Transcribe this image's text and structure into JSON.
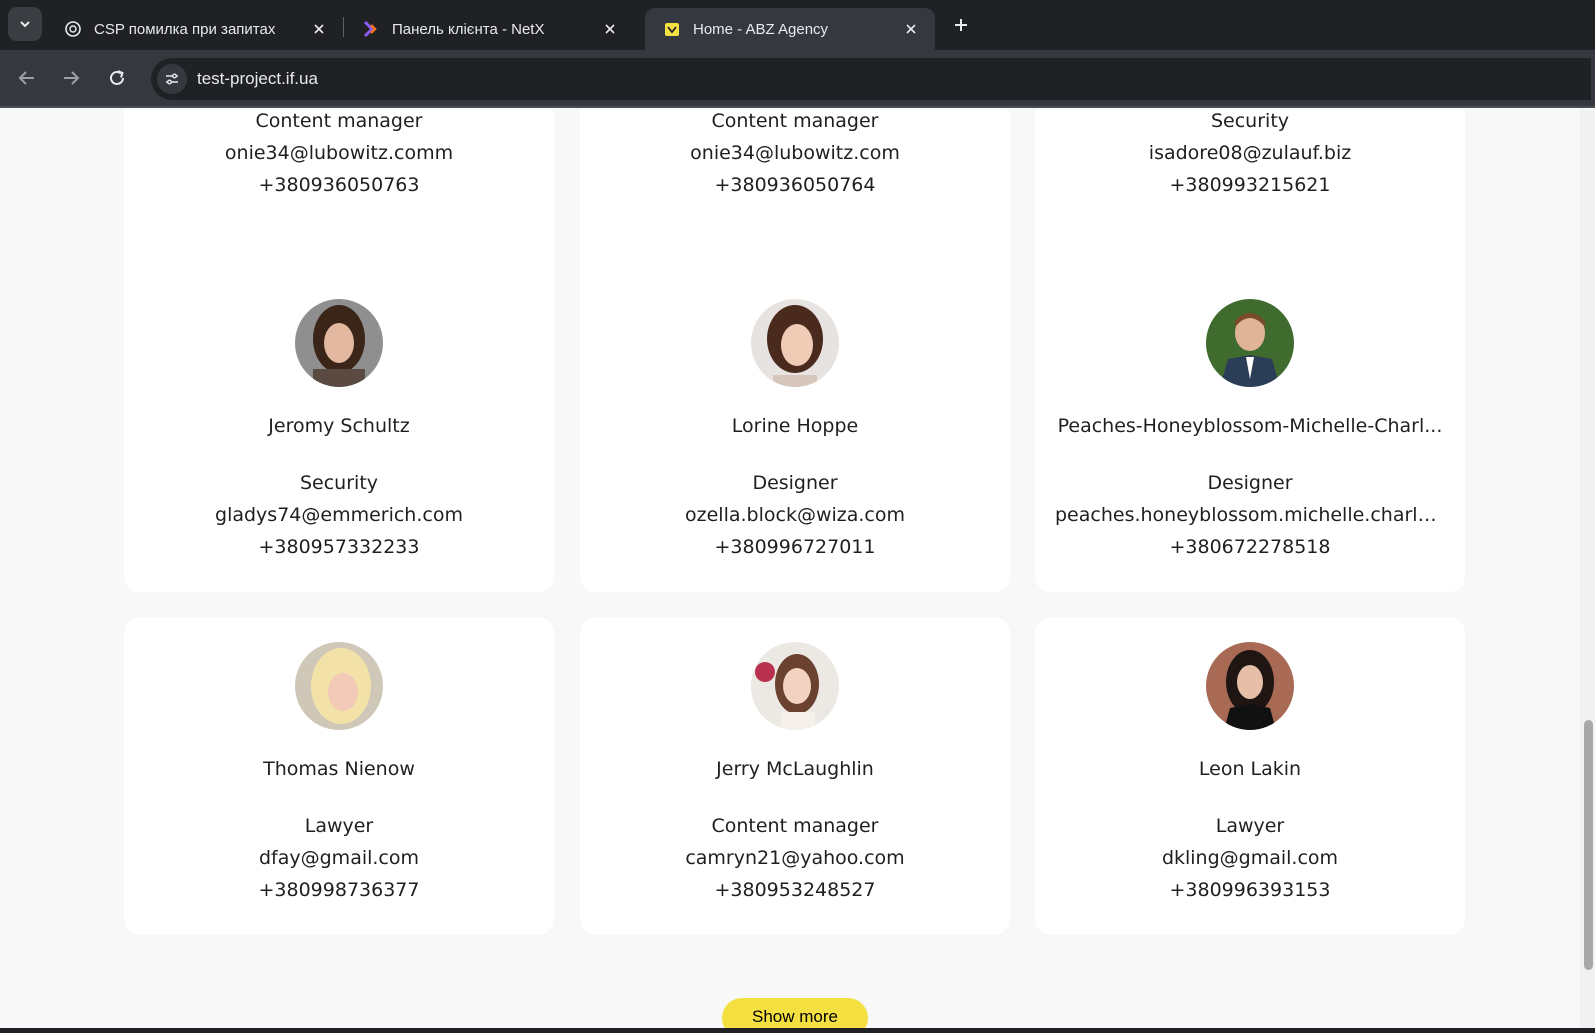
{
  "browser": {
    "tabs": [
      {
        "title": "CSP помилка при запитах",
        "active": false
      },
      {
        "title": "Панель клієнта - NetX",
        "active": false
      },
      {
        "title": "Home - ABZ Agency",
        "active": true
      }
    ],
    "url": "test-project.if.ua"
  },
  "users": [
    {
      "position": "Content manager",
      "email": "onie34@lubowitz.comm",
      "phone": "+380936050763"
    },
    {
      "position": "Content manager",
      "email": "onie34@lubowitz.com",
      "phone": "+380936050764"
    },
    {
      "position": "Security",
      "email": "isadore08@zulauf.biz",
      "phone": "+380993215621"
    },
    {
      "name": "Jeromy Schultz",
      "position": "Security",
      "email": "gladys74@emmerich.com",
      "phone": "+380957332233"
    },
    {
      "name": "Lorine Hoppe",
      "position": "Designer",
      "email": "ozella.block@wiza.com",
      "phone": "+380996727011"
    },
    {
      "name": "Peaches-Honeyblossom-Michelle-Charl...",
      "position": "Designer",
      "email": "peaches.honeyblossom.michelle.charlott...",
      "phone": "+380672278518"
    },
    {
      "name": "Thomas Nienow",
      "position": "Lawyer",
      "email": "dfay@gmail.com",
      "phone": "+380998736377"
    },
    {
      "name": "Jerry McLaughlin",
      "position": "Content manager",
      "email": "camryn21@yahoo.com",
      "phone": "+380953248527"
    },
    {
      "name": "Leon Lakin",
      "position": "Lawyer",
      "email": "dkling@gmail.com",
      "phone": "+380996393153"
    }
  ],
  "show_more_label": "Show more",
  "colors": {
    "button": "#f4e041",
    "card": "#ffffff",
    "page": "#f8f8f8"
  }
}
